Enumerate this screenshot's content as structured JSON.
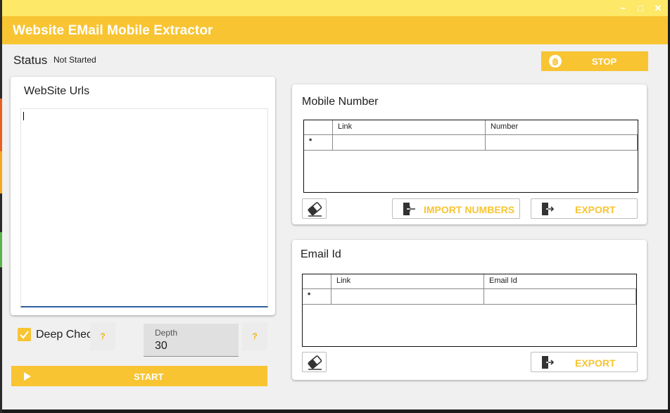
{
  "window": {
    "title": "Website EMail Mobile Extractor",
    "controls": {
      "minimize": "−",
      "maximize": "□",
      "close": "✕"
    }
  },
  "status": {
    "label": "Status",
    "value": "Not Started"
  },
  "stop_button": {
    "label": "STOP",
    "icon": "hand-stop-icon"
  },
  "website_urls": {
    "title": "WebSite Urls",
    "value": ""
  },
  "options": {
    "deep_check_label": "Deep Check",
    "deep_check_checked": true,
    "help": "?",
    "depth_label": "Depth",
    "depth_value": "30"
  },
  "start_button": {
    "label": "START",
    "icon": "play-icon"
  },
  "mobile_panel": {
    "title": "Mobile Number",
    "columns": [
      "Link",
      "Number"
    ],
    "new_row_marker": "*",
    "clear_icon": "eraser-icon",
    "import_label": "IMPORT NUMBERS",
    "export_label": "EXPORT"
  },
  "email_panel": {
    "title": "Email Id",
    "columns": [
      "Link",
      "Email Id"
    ],
    "new_row_marker": "*",
    "clear_icon": "eraser-icon",
    "export_label": "EXPORT"
  },
  "colors": {
    "accent": "#f8c432",
    "topbar": "#fde867",
    "text": "#202020"
  }
}
